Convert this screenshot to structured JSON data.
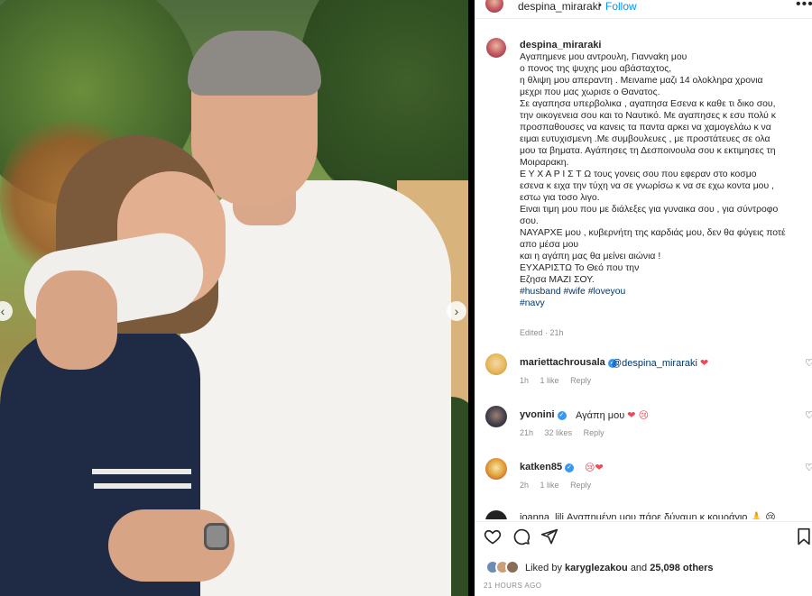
{
  "header": {
    "username": "despina_miraraki",
    "dot": "•",
    "follow_label": "Follow",
    "more_icon": "more-horizontal-icon"
  },
  "caption": {
    "username": "despina_miraraki",
    "lines": [
      "Αγαπημενε μου αντρουλη, Γιανναkη μου",
      "ο πονος της ψυχης μου αβάσταχτος,",
      "η θλιψη μου απεραντη . Μεινame μαζι 14 ολοkληρα χρονια",
      "μεχρι που μας χωρισε ο Θανατος.",
      "Σε αγαπησα υπερβολικα , αγαπησα Εσενα κ καθε τι δικο σου,",
      "την οικογενεια σου και το Ναυτικό. Με αγαπησες κ εσυ πολύ κ",
      "προσπαθουσες να κανεις τα παντα αρκει να χαμογελάω κ να",
      "ειμαι ευτυχισμενη .Με συμβουλευες , με προστάτευες σε ολα",
      "μου τα βηματα. Αγάπησες τη Δεσποινουλα σου κ εκτιμησες τη",
      "Μοιραρακη.",
      "Ε Υ Χ Α Ρ Ι Σ Τ Ω τους γονεις σου που εφεραν στο κοσμο",
      "εσενα κ ειχα την τύχη να σε γνωρίσω κ να σε εχω κοντα μου ,",
      "εστω για τοσο λιγο.",
      "Ειναι τιμη μου που με διάλεξες για γυναικα σου , για σύντροφο",
      "σου.",
      "ΝΑΥΑΡΧΕ μου , κυβερνήτη της καρδιάς μου, δεν θα φύγεις ποτέ",
      "απο μέσα μου",
      "και η αγάπη μας θα μείνει αιώνια !",
      "ΕΥΧΑΡΙΣΤΩ Το Θεό που την",
      "Εζησα ΜΑΖΙ ΣΟΥ."
    ],
    "hashtags": [
      "#husband",
      "#wife",
      "#loveyou"
    ],
    "hashtag_last": "#navy",
    "edited": "Edited · 21h"
  },
  "comments": [
    {
      "username": "mariettachrousala",
      "verified": true,
      "mention": "@despina_miraraki",
      "text": "",
      "emoji": "❤",
      "time": "1h",
      "likes": "1 like",
      "reply": "Reply"
    },
    {
      "username": "yvonini",
      "verified": true,
      "mention": "",
      "text": "Αγάπη μου",
      "emoji": "❤ 😢",
      "time": "21h",
      "likes": "32 likes",
      "reply": "Reply"
    },
    {
      "username": "katken85",
      "verified": true,
      "mention": "",
      "text": "",
      "emoji": "😢❤",
      "time": "2h",
      "likes": "1 like",
      "reply": "Reply"
    }
  ],
  "partial_comment": "ioanna_lili Αγαπημένη μου πάρε δύναμη κ κουράγιο 🙏 😢",
  "actions": {
    "like_icon": "heart-outline-icon",
    "comment_icon": "comment-icon",
    "share_icon": "paper-plane-icon",
    "save_icon": "bookmark-icon"
  },
  "likes": {
    "prefix": "Liked by",
    "user": "karyglezakou",
    "middle": "and",
    "count": "25,098 others"
  },
  "timestamp": "21 HOURS AGO",
  "colors": {
    "follow": "#0095f6",
    "hashtag": "#00376b",
    "heart": "#ed4956",
    "verified": "#3897f0"
  }
}
